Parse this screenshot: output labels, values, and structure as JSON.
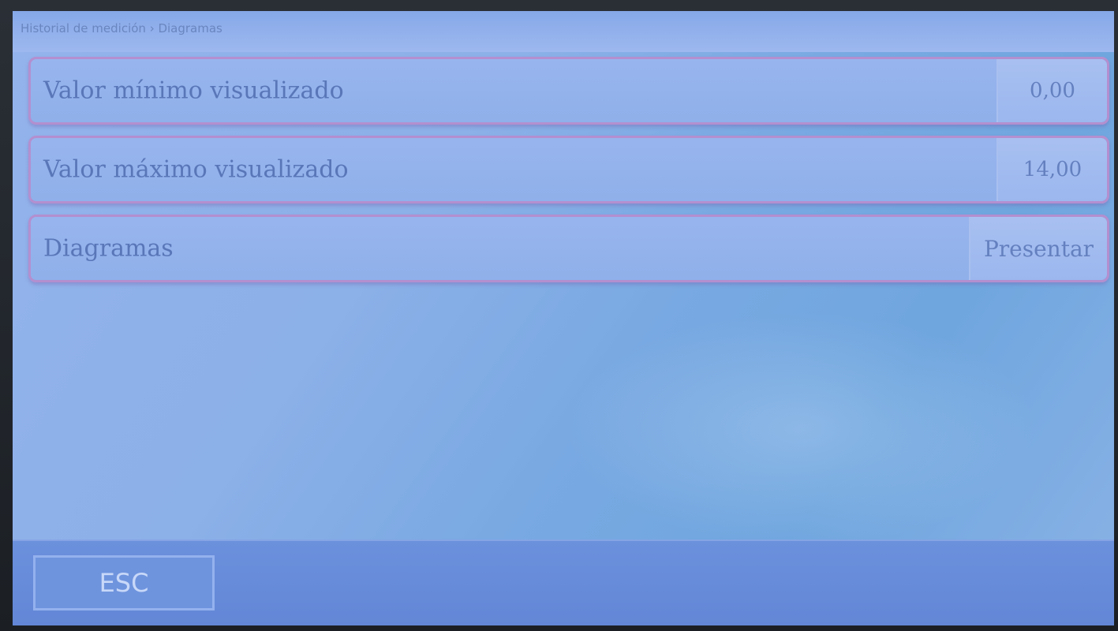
{
  "breadcrumb": "Historial de medición › Diagramas",
  "rows": [
    {
      "label": "Valor mínimo visualizado",
      "value": "0,00"
    },
    {
      "label": "Valor máximo visualizado",
      "value": "14,00"
    },
    {
      "label": "Diagramas",
      "action": "Presentar"
    }
  ],
  "footer": {
    "esc_label": "ESC"
  },
  "colors": {
    "screen_bg": "#8cb0e8",
    "row_border": "#b38fcf",
    "text": "#5977b8",
    "footer_bg": "#6387d6"
  }
}
